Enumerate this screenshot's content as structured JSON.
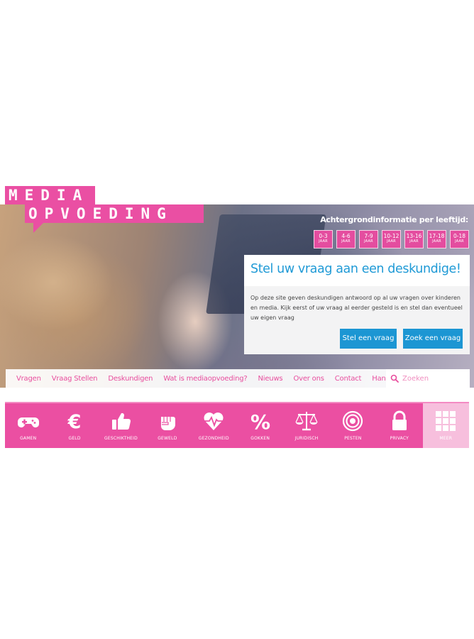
{
  "logo": {
    "line1": "MEDIA",
    "line2": "OPVOEDING"
  },
  "age": {
    "heading": "Achtergrondinformatie per leeftijd:",
    "groups": [
      {
        "range": "0-3",
        "unit": "JAAR"
      },
      {
        "range": "4-6",
        "unit": "JAAR"
      },
      {
        "range": "7-9",
        "unit": "JAAR"
      },
      {
        "range": "10-12",
        "unit": "JAAR"
      },
      {
        "range": "13-16",
        "unit": "JAAR"
      },
      {
        "range": "17-18",
        "unit": "JAAR"
      },
      {
        "range": "0-18",
        "unit": "JAAR"
      }
    ]
  },
  "panel": {
    "title": "Stel uw vraag aan een deskundige!",
    "text": "Op deze site geven deskundigen antwoord op al uw vragen over kinderen en media. Kijk eerst of uw vraag al eerder gesteld is en stel dan eventueel uw eigen vraag",
    "ask_label": "Stel een vraag",
    "search_label": "Zoek een vraag"
  },
  "nav": {
    "items": [
      "Vragen",
      "Vraag Stellen",
      "Deskundigen",
      "Wat is mediaopvoeding?",
      "Nieuws",
      "Over ons",
      "Contact",
      "Handige links"
    ],
    "search_placeholder": "Zoeken"
  },
  "categories": [
    {
      "label": "GAMEN",
      "icon": "gamepad-icon"
    },
    {
      "label": "GELD",
      "icon": "euro-icon"
    },
    {
      "label": "GESCHIKTHEID",
      "icon": "thumbs-up-icon"
    },
    {
      "label": "GEWELD",
      "icon": "fist-icon"
    },
    {
      "label": "GEZONDHEID",
      "icon": "heart-pulse-icon"
    },
    {
      "label": "GOKKEN",
      "icon": "percent-icon"
    },
    {
      "label": "JURIDISCH",
      "icon": "scales-icon"
    },
    {
      "label": "PESTEN",
      "icon": "target-icon"
    },
    {
      "label": "PRIVACY",
      "icon": "lock-icon"
    },
    {
      "label": "MEER",
      "icon": "grid-icon"
    }
  ],
  "colors": {
    "pink": "#eb4fa2",
    "blue": "#1c96d3",
    "light_pink": "#f7bfdd"
  }
}
